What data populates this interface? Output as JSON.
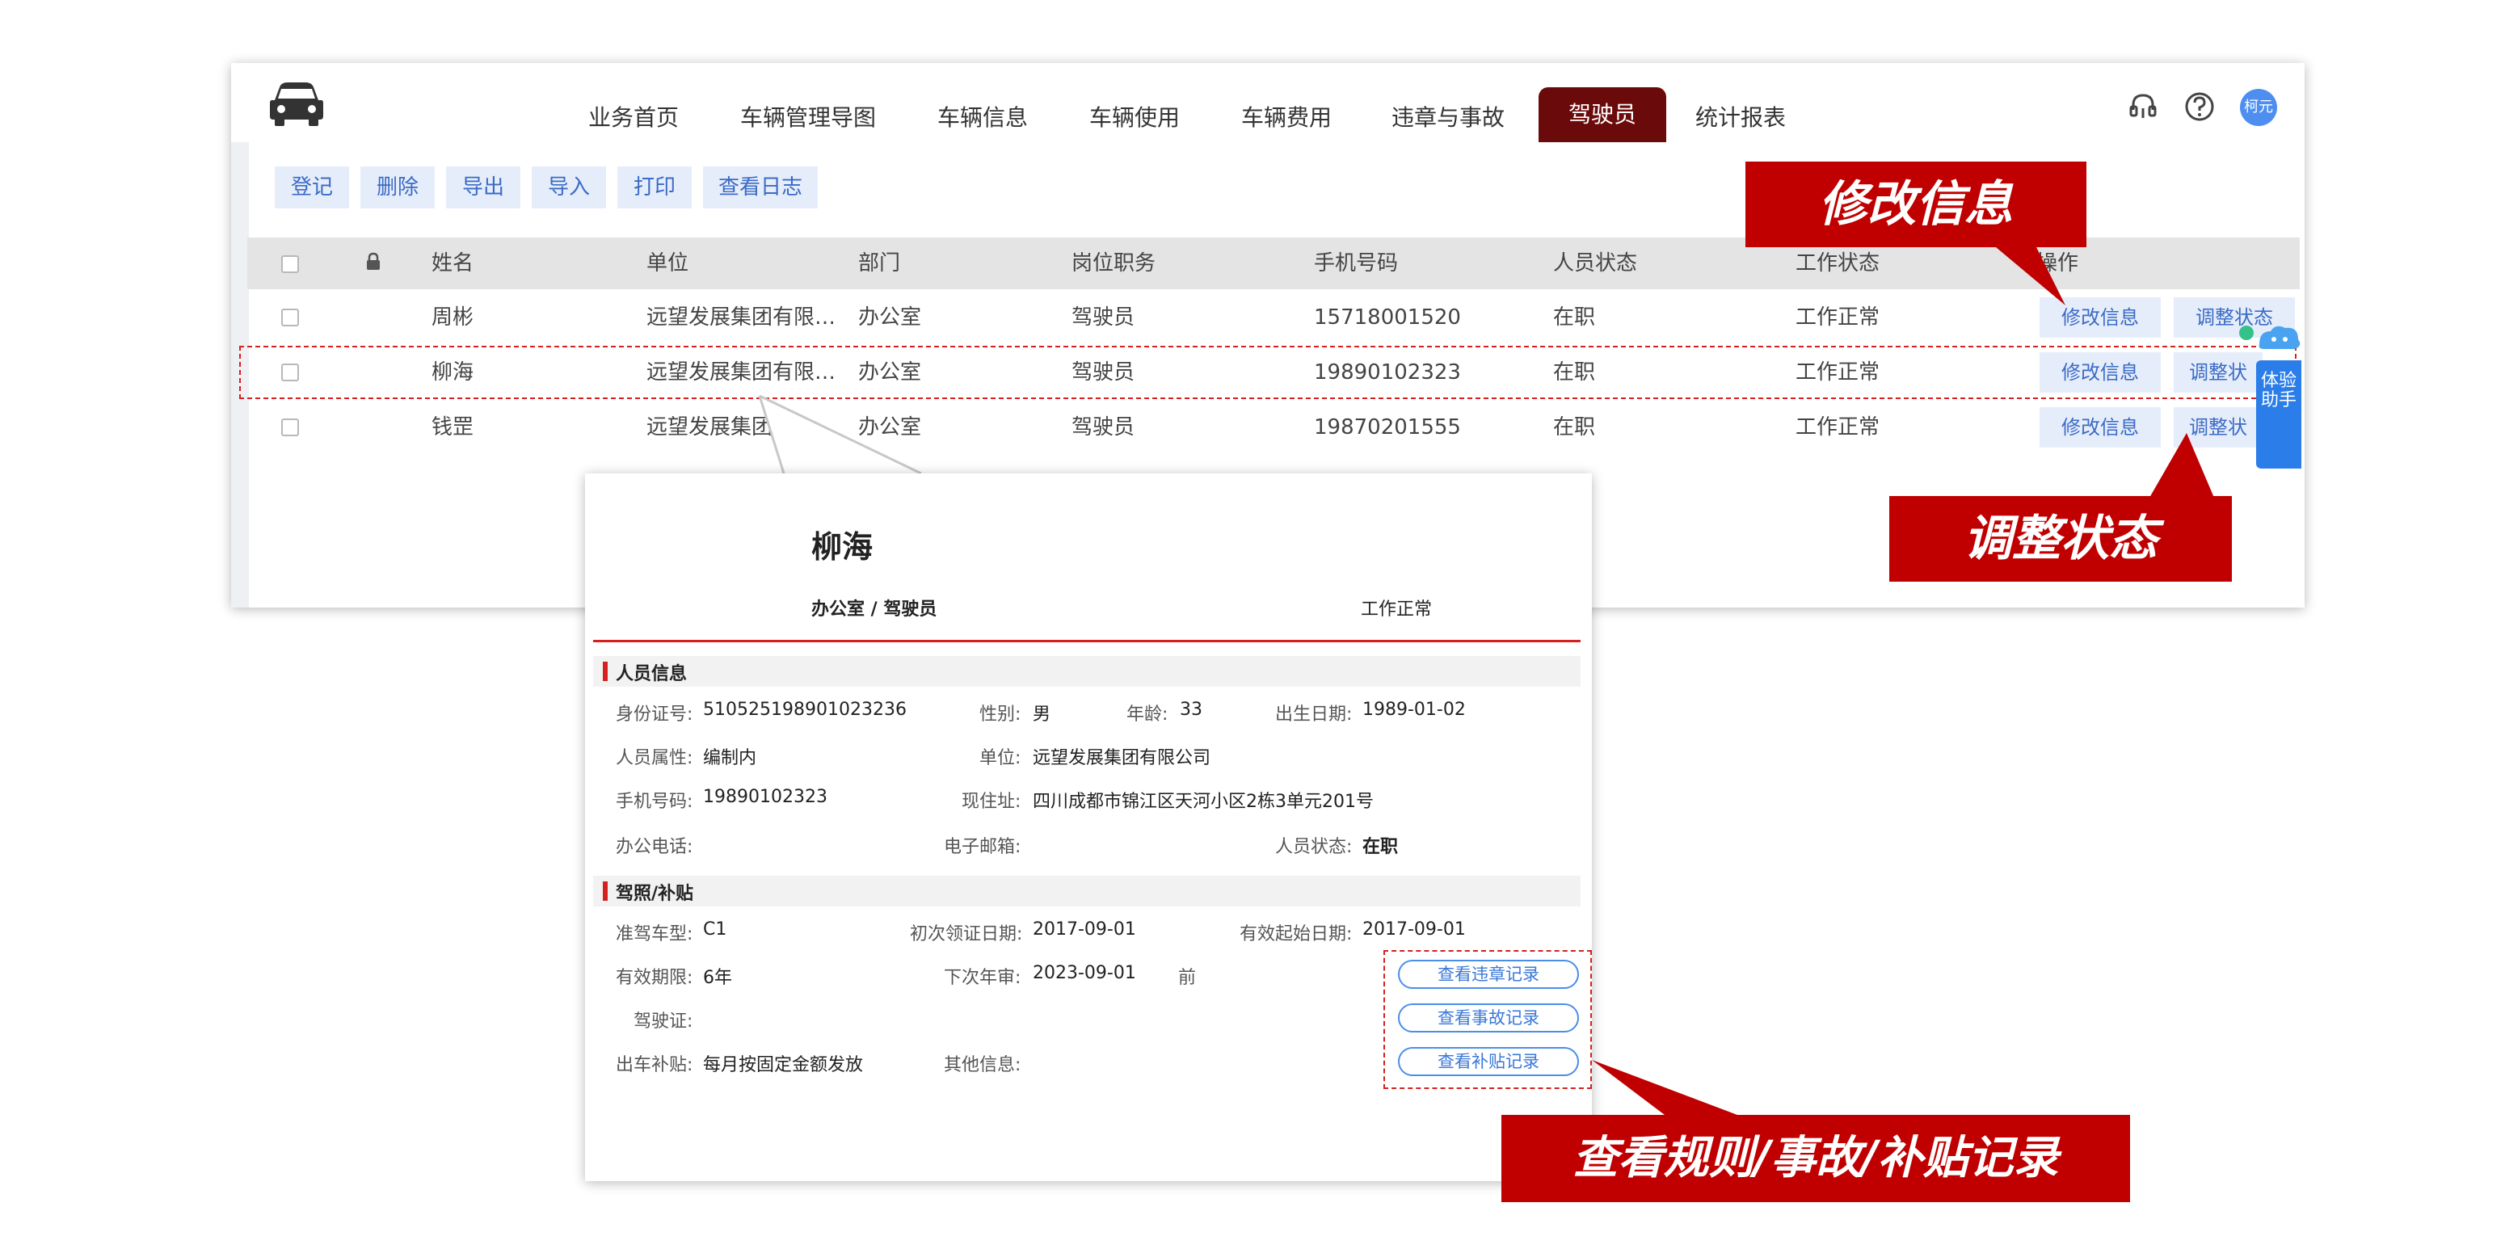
{
  "nav": {
    "items": [
      "业务首页",
      "车辆管理导图",
      "车辆信息",
      "车辆使用",
      "车辆费用",
      "违章与事故",
      "驾驶员",
      "统计报表"
    ],
    "active": "驾驶员",
    "avatar_text": "柯元"
  },
  "toolbar": {
    "buttons": [
      "登记",
      "删除",
      "导出",
      "导入",
      "打印",
      "查看日志"
    ]
  },
  "table": {
    "headers": [
      "姓名",
      "单位",
      "部门",
      "岗位职务",
      "手机号码",
      "人员状态",
      "工作状态",
      "操作"
    ],
    "rows": [
      {
        "name": "周彬",
        "unit": "远望发展集团有限…",
        "dept": "办公室",
        "post": "驾驶员",
        "phone": "15718001520",
        "person_status": "在职",
        "work_status": "工作正常",
        "btn_edit": "修改信息",
        "btn_status": "调整状态"
      },
      {
        "name": "柳海",
        "unit": "远望发展集团有限…",
        "dept": "办公室",
        "post": "驾驶员",
        "phone": "19890102323",
        "person_status": "在职",
        "work_status": "工作正常",
        "btn_edit": "修改信息",
        "btn_status": "调整状"
      },
      {
        "name": "钱罡",
        "unit": "远望发展集团有",
        "dept": "办公室",
        "post": "驾驶员",
        "phone": "19870201555",
        "person_status": "在职",
        "work_status": "工作正常",
        "btn_edit": "修改信息",
        "btn_status": "调整状"
      }
    ]
  },
  "assistant": {
    "label": "体验助手"
  },
  "card": {
    "name": "柳海",
    "subtitle": "办公室 / 驾驶员",
    "work_status": "工作正常",
    "section1": {
      "title": "人员信息",
      "id_label": "身份证号:",
      "id_value": "510525198901023236",
      "gender_label": "性别:",
      "gender_value": "男",
      "age_label": "年龄:",
      "age_value": "33",
      "birth_label": "出生日期:",
      "birth_value": "1989-01-02",
      "attr_label": "人员属性:",
      "attr_value": "编制内",
      "unit_label": "单位:",
      "unit_value": "远望发展集团有限公司",
      "phone_label": "手机号码:",
      "phone_value": "19890102323",
      "addr_label": "现住址:",
      "addr_value": "四川成都市锦江区天河小区2栋3单元201号",
      "office_label": "办公电话:",
      "email_label": "电子邮箱:",
      "pstatus_label": "人员状态:",
      "pstatus_value": "在职"
    },
    "section2": {
      "title": "驾照/补贴",
      "type_label": "准驾车型:",
      "type_value": "C1",
      "first_label": "初次领证日期:",
      "first_value": "2017-09-01",
      "start_label": "有效起始日期:",
      "start_value": "2017-09-01",
      "period_label": "有效期限:",
      "period_value": "6年",
      "next_label": "下次年审:",
      "next_value": "2023-09-01",
      "next_suffix": "前",
      "license_label": "驾驶证:",
      "subsidy_label": "出车补贴:",
      "subsidy_value": "每月按固定金额发放",
      "other_label": "其他信息:",
      "btn_violation": "查看违章记录",
      "btn_accident": "查看事故记录",
      "btn_subsidy": "查看补贴记录"
    }
  },
  "callouts": {
    "edit": "修改信息",
    "status": "调整状态",
    "records": "查看规则/事故/补贴记录"
  },
  "colors": {
    "accent": "#6b0a0a",
    "callout": "#c00000",
    "link": "#3a6bc6"
  }
}
